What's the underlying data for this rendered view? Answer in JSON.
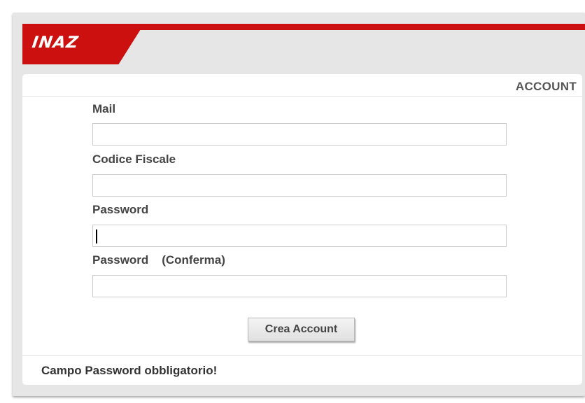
{
  "brand": {
    "logo_text": "INAZ",
    "accent_color": "#cc1010"
  },
  "form": {
    "section_title": "ACCOUNT",
    "fields": [
      {
        "label": "Mail",
        "value": ""
      },
      {
        "label": "Codice Fiscale",
        "value": ""
      },
      {
        "label": "Password",
        "value": ""
      },
      {
        "label": "Password    (Conferma)",
        "value": ""
      }
    ],
    "submit_label": "Crea Account",
    "status_message": "Campo Password obbligatorio!"
  }
}
